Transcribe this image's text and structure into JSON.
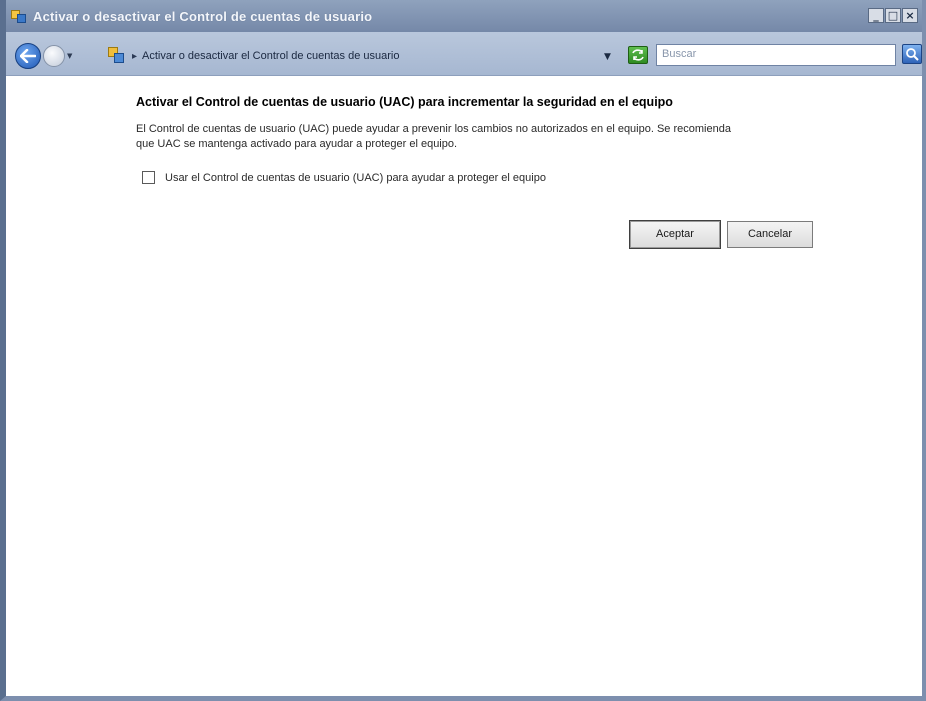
{
  "window": {
    "title": "Activar o desactivar el Control de cuentas de usuario",
    "caption_buttons": {
      "minimize": "_",
      "maximize": "□",
      "close": "×"
    }
  },
  "addressbar": {
    "breadcrumb_separator": "▸",
    "address_text": "Activar o desactivar el Control de cuentas de usuario",
    "dropdown_glyph": "▼",
    "history_glyph": "▼",
    "search_placeholder": "Buscar"
  },
  "content": {
    "heading": "Activar el Control de cuentas de usuario (UAC) para incrementar la seguridad en el equipo",
    "description_line1": "El Control de cuentas de usuario (UAC) puede ayudar a prevenir los cambios no autorizados en el equipo. Se recomienda",
    "description_line2": "que UAC se mantenga activado para ayudar a proteger el equipo.",
    "checkbox_label": "Usar el Control de cuentas de usuario (UAC) para ayudar a proteger el equipo",
    "checkbox_checked": false,
    "ok_label": "Aceptar",
    "cancel_label": "Cancelar"
  },
  "colors": {
    "titlebar": "#7f92b0",
    "addressbar": "#b0c0d8",
    "window_frame": "#5a6f8f"
  }
}
